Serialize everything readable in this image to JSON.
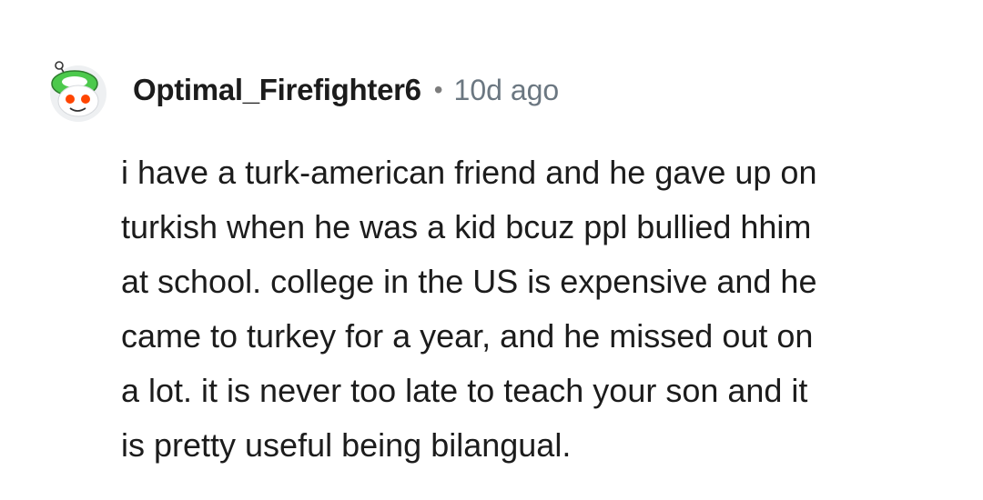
{
  "comment": {
    "author": {
      "username": "Optimal_Firefighter6",
      "avatar_icon": "snoo-avatar-icon"
    },
    "separator": "•",
    "timestamp": "10d ago",
    "body_lines": [
      "i have a turk-american friend and he gave up on",
      "turkish when he was a kid bcuz ppl bullied hhim",
      "at school. college in the US is expensive and he",
      "came to turkey for a year, and he missed out on",
      "a lot. it is never too late to teach your son and it",
      "is pretty useful being bilangual."
    ]
  },
  "colors": {
    "background": "#ffffff",
    "username": "#1c1c1c",
    "timestamp": "#6b7781",
    "avatar_accent": "#4cc94c",
    "avatar_eyes": "#ff4500"
  }
}
